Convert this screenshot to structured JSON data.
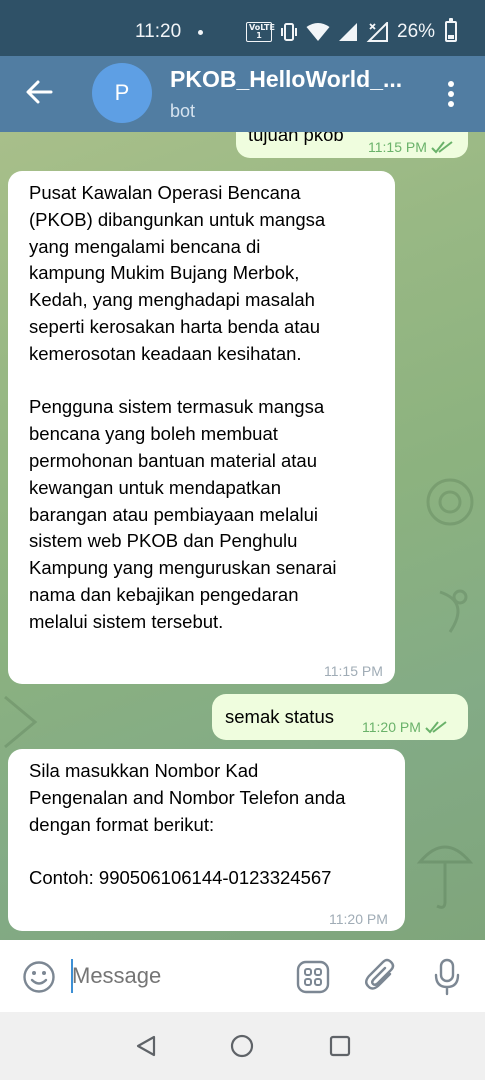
{
  "status_bar": {
    "time": "11:20",
    "volte": "VoLTE 1",
    "battery_pct": "26%",
    "battery_level": 0.26
  },
  "header": {
    "avatar_letter": "P",
    "title": "PKOB_HelloWorld_...",
    "subtitle": "bot"
  },
  "messages": [
    {
      "id": "m0",
      "direction": "outgoing",
      "text": "tujuan pkob",
      "time": "11:15 PM",
      "read": true
    },
    {
      "id": "m1",
      "direction": "incoming",
      "text": "Pusat Kawalan Operasi Bencana\n(PKOB) dibangunkan untuk mangsa\nyang mengalami bencana di\nkampung Mukim Bujang Merbok,\nKedah, yang menghadapi masalah\nseperti kerosakan harta benda atau\nkemerosotan keadaan kesihatan.\n\nPengguna sistem termasuk mangsa\nbencana yang boleh membuat\npermohonan bantuan material atau\nkewangan untuk mendapatkan\nbarangan atau pembiayaan melalui\nsistem web PKOB dan Penghulu\nKampung yang menguruskan senarai\nnama dan kebajikan pengedaran\nmelalui sistem tersebut.",
      "time": "11:15 PM"
    },
    {
      "id": "m2",
      "direction": "outgoing",
      "text": "semak status",
      "time": "11:20 PM",
      "read": true
    },
    {
      "id": "m3",
      "direction": "incoming",
      "text": "Sila masukkan Nombor Kad\nPengenalan and Nombor Telefon anda\ndengan format berikut:\n\nContoh: 990506106144-0123324567",
      "time": "11:20 PM"
    }
  ],
  "input": {
    "placeholder": "Message"
  },
  "icons": {
    "back": "arrow-left-icon",
    "menu": "more-vertical-icon",
    "emoji": "smile-icon",
    "commands": "bot-commands-icon",
    "attach": "paperclip-icon",
    "mic": "microphone-icon",
    "nav_back": "triangle-back-icon",
    "nav_home": "circle-home-icon",
    "nav_recents": "square-recents-icon"
  },
  "colors": {
    "header": "#517da2",
    "status_bar": "#2f5167",
    "avatar": "#5e9fe4",
    "outgoing_bubble": "#effdde",
    "incoming_bubble": "#ffffff",
    "read_check": "#6ab26a",
    "caret": "#3d8fd4"
  }
}
